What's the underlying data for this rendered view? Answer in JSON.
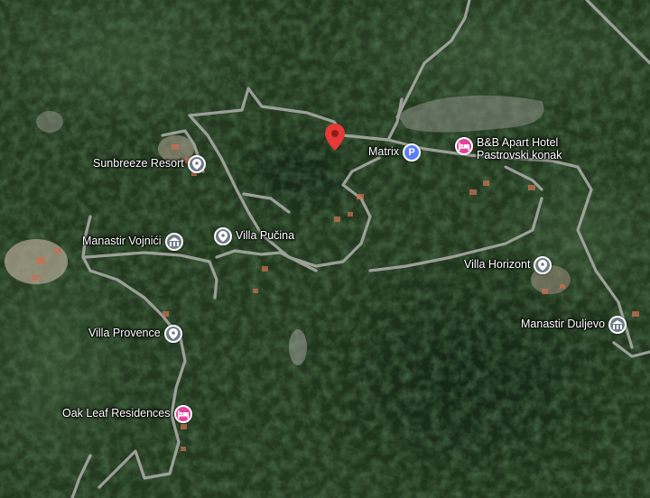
{
  "map": {
    "type": "satellite",
    "colors": {
      "vegetation_dark": "#1d3320",
      "vegetation_mid": "#2f4a2c",
      "road": "#a9aaa6",
      "label_text": "#ffffff",
      "pin_gray": "#6f7b86",
      "hotel_pink": "#e2439a",
      "parking_blue": "#5c7ef2",
      "dropped_pin_red": "#e53935"
    }
  },
  "dropped_pin": {
    "icon": "red-location-pin-icon"
  },
  "pois": {
    "sunbreeze": {
      "label": "Sunbreeze Resort",
      "icon": "pin-icon"
    },
    "vojnici": {
      "label": "Manastir Vojnići",
      "icon": "monastery-icon"
    },
    "pucina": {
      "label": "Villa Pučina",
      "icon": "pin-icon"
    },
    "provence": {
      "label": "Villa Provence",
      "icon": "pin-icon"
    },
    "oakleaf": {
      "label": "Oak Leaf Residences",
      "icon": "hotel-bed-icon"
    },
    "matrix": {
      "label": "Matrix",
      "icon": "parking-icon",
      "icon_text": "P"
    },
    "bb_apart": {
      "label_line1": "B&B Apart Hotel",
      "label_line2": "Pastrovski konak",
      "icon": "hotel-bed-icon"
    },
    "horizont": {
      "label": "Villa Horizont",
      "icon": "pin-icon"
    },
    "duljevo": {
      "label": "Manastir Duljevo",
      "icon": "monastery-icon"
    }
  }
}
